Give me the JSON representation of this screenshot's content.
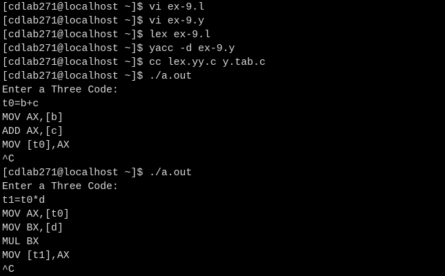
{
  "terminal": {
    "lines": [
      "[cdlab271@localhost ~]$ vi ex-9.l",
      "[cdlab271@localhost ~]$ vi ex-9.y",
      "[cdlab271@localhost ~]$ lex ex-9.l",
      "[cdlab271@localhost ~]$ yacc -d ex-9.y",
      "[cdlab271@localhost ~]$ cc lex.yy.c y.tab.c",
      "[cdlab271@localhost ~]$ ./a.out",
      "Enter a Three Code:",
      "t0=b+c",
      "MOV AX,[b]",
      "ADD AX,[c]",
      "MOV [t0],AX",
      "^C",
      "[cdlab271@localhost ~]$ ./a.out",
      "Enter a Three Code:",
      "t1=t0*d",
      "MOV AX,[t0]",
      "MOV BX,[d]",
      "MUL BX",
      "MOV [t1],AX",
      "^C"
    ]
  },
  "colors": {
    "background": "#000000",
    "text": "#d8d8d8"
  }
}
